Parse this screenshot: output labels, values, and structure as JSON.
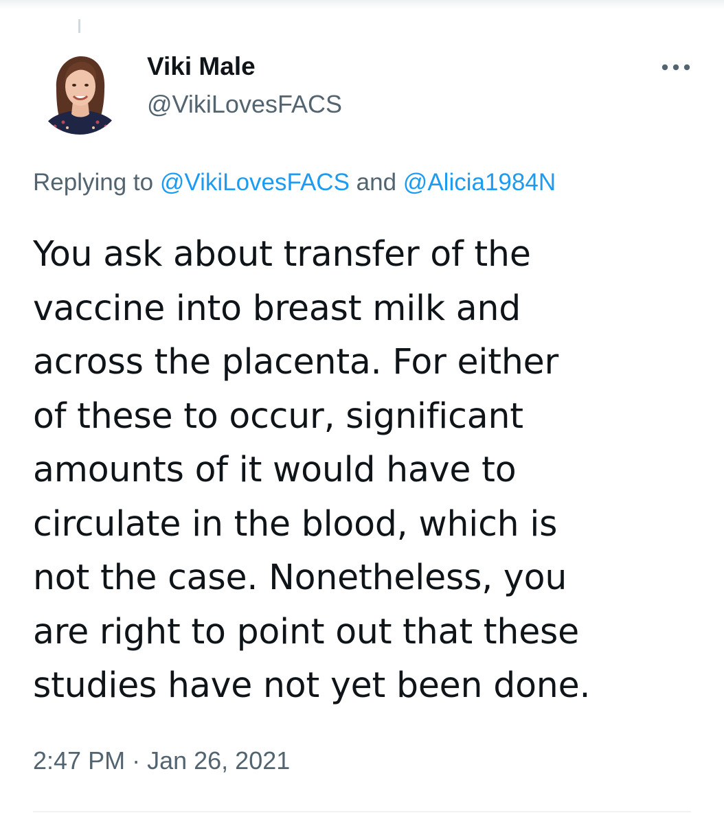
{
  "tweet": {
    "author": {
      "display_name": "Viki Male",
      "handle": "@VikiLovesFACS",
      "avatar_icon": "profile-photo"
    },
    "more_icon": "more-horizontal-icon",
    "reply_context": {
      "prefix": "Replying to ",
      "mentions": [
        "@VikiLovesFACS",
        "@Alicia1984N"
      ],
      "joiner": " and "
    },
    "text": "You ask about transfer of the\nvaccine into breast milk and\nacross the placenta. For either\nof these to occur, significant\namounts of it would have to\ncirculate in the blood, which is\nnot the case. Nonetheless, you\nare right to point out that these\nstudies have not yet been done.",
    "timestamp": {
      "time": "2:47 PM",
      "separator": " · ",
      "date": "Jan 26, 2021"
    }
  },
  "colors": {
    "text_primary": "#0f1419",
    "text_secondary": "#536471",
    "link": "#1d9bf0",
    "divider": "#eff3f4"
  }
}
